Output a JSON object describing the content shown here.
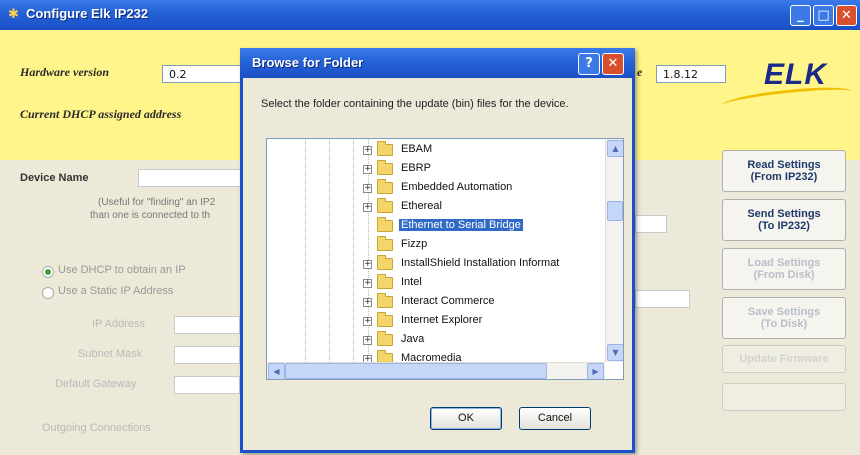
{
  "main_window": {
    "title": "Configure Elk IP232",
    "title_icon": "app-icon",
    "controls": {
      "minimize": "_",
      "maximize": "□",
      "close": "✕"
    }
  },
  "header": {
    "hardware_version_label": "Hardware version",
    "hardware_version_value": "0.2",
    "firmware_value": "1.8.12",
    "firmware_label_partial": "e",
    "current_dhcp_label": "Current DHCP assigned address",
    "logo_text": "ELK"
  },
  "device": {
    "name_label": "Device Name",
    "hint_line1": "(Useful for \"finding\" an IP2",
    "hint_line2": "than one is connected to th"
  },
  "network": {
    "use_dhcp_label": "Use DHCP to obtain an IP",
    "use_static_label": "Use a Static IP Address",
    "ip_address_label": "IP Address",
    "subnet_mask_label": "Subnet Mask",
    "default_gateway_label": "Default Gateway",
    "outgoing_label": "Outgoing Connections"
  },
  "side_buttons": {
    "read_settings": [
      "Read Settings",
      "(From IP232)"
    ],
    "send_settings": [
      "Send Settings",
      "(To IP232)"
    ],
    "load_settings": [
      "Load Settings",
      "(From Disk)"
    ],
    "save_settings": [
      "Save Settings",
      "(To Disk)"
    ],
    "update_firmware": "Update Firmware"
  },
  "dialog": {
    "title": "Browse for Folder",
    "help_glyph": "?",
    "close_glyph": "✕",
    "instruction": "Select the folder containing the update (bin) files for the device.",
    "tree_items": [
      {
        "label": "EBAM",
        "expander": "+",
        "selected": false
      },
      {
        "label": "EBRP",
        "expander": "+",
        "selected": false
      },
      {
        "label": "Embedded Automation",
        "expander": "+",
        "selected": false
      },
      {
        "label": "Ethereal",
        "expander": "+",
        "selected": false
      },
      {
        "label": "Ethernet to Serial Bridge",
        "expander": "",
        "selected": true
      },
      {
        "label": "Fizzp",
        "expander": "",
        "selected": false
      },
      {
        "label": "InstallShield Installation Informat",
        "expander": "+",
        "selected": false
      },
      {
        "label": "Intel",
        "expander": "+",
        "selected": false
      },
      {
        "label": "Interact Commerce",
        "expander": "+",
        "selected": false
      },
      {
        "label": "Internet Explorer",
        "expander": "+",
        "selected": false
      },
      {
        "label": "Java",
        "expander": "+",
        "selected": false
      },
      {
        "label": "Macromedia",
        "expander": "+",
        "selected": false
      }
    ],
    "ok_label": "OK",
    "cancel_label": "Cancel"
  },
  "colors": {
    "titlebar": "#2563d8",
    "header_band": "#fff58a",
    "selection": "#316ac5",
    "logo": "#1a2a86"
  }
}
